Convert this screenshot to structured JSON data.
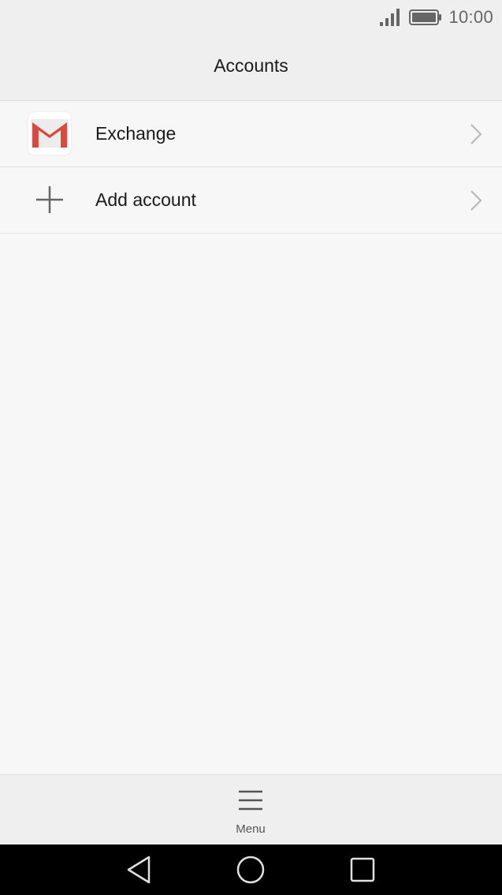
{
  "status_bar": {
    "time": "10:00",
    "signal_icon": "signal-bars-icon",
    "battery_icon": "battery-full-icon"
  },
  "header": {
    "title": "Accounts"
  },
  "accounts": [
    {
      "label": "Exchange",
      "icon": "gmail-icon"
    },
    {
      "label": "Add account",
      "icon": "plus-icon"
    }
  ],
  "bottom_bar": {
    "menu_label": "Menu",
    "menu_icon": "hamburger-menu-icon"
  },
  "nav_bar": {
    "buttons": [
      "back-icon",
      "home-icon",
      "recents-icon"
    ]
  },
  "colors": {
    "gmail_red": "#d54b3d",
    "background": "#f7f7f7",
    "header_bg": "#efefef",
    "nav_bg": "#000000"
  }
}
